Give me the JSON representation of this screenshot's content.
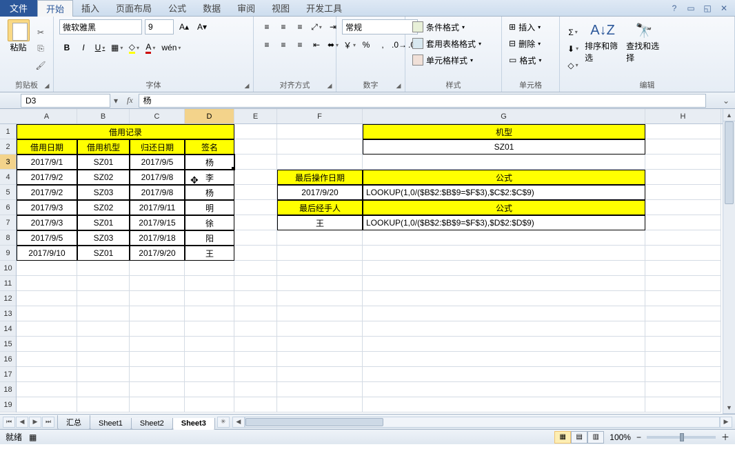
{
  "tabs": {
    "file": "文件",
    "items": [
      "开始",
      "插入",
      "页面布局",
      "公式",
      "数据",
      "审阅",
      "视图",
      "开发工具"
    ],
    "active": 0
  },
  "ribbon": {
    "clipboard": {
      "title": "剪贴板",
      "paste": "粘贴"
    },
    "font": {
      "title": "字体",
      "name": "微软雅黑",
      "size": "9",
      "bold": "B",
      "italic": "I",
      "underline": "U"
    },
    "align": {
      "title": "对齐方式"
    },
    "number": {
      "title": "数字",
      "format": "常规"
    },
    "styles": {
      "title": "样式",
      "cond": "条件格式",
      "tbl": "套用表格格式",
      "cell": "单元格样式"
    },
    "cells": {
      "title": "单元格",
      "ins": "插入",
      "del": "删除",
      "fmt": "格式"
    },
    "edit": {
      "title": "编辑",
      "sort": "排序和筛选",
      "find": "查找和选择"
    }
  },
  "namebox": "D3",
  "formula": "杨",
  "cols": [
    "A",
    "B",
    "C",
    "D",
    "E",
    "F",
    "G",
    "H"
  ],
  "selCol": 3,
  "selRow": 3,
  "data": {
    "title1": "借用记录",
    "h": [
      "借用日期",
      "借用机型",
      "归还日期",
      "签名"
    ],
    "rows": [
      [
        "2017/9/1",
        "SZ01",
        "2017/9/5",
        "杨"
      ],
      [
        "2017/9/2",
        "SZ02",
        "2017/9/8",
        "李"
      ],
      [
        "2017/9/2",
        "SZ03",
        "2017/9/8",
        "杨"
      ],
      [
        "2017/9/3",
        "SZ02",
        "2017/9/11",
        "明"
      ],
      [
        "2017/9/3",
        "SZ01",
        "2017/9/15",
        "徐"
      ],
      [
        "2017/9/5",
        "SZ03",
        "2017/9/18",
        "阳"
      ],
      [
        "2017/9/10",
        "SZ01",
        "2017/9/20",
        "王"
      ]
    ],
    "title2": "机型",
    "model": "SZ01",
    "h2a": "最后操作日期",
    "h2b": "公式",
    "v2a": "2017/9/20",
    "v2b": "LOOKUP(1,0/($B$2:$B$9=$F$3),$C$2:$C$9)",
    "h3a": "最后经手人",
    "h3b": "公式",
    "v3a": "王",
    "v3b": "LOOKUP(1,0/($B$2:$B$9=$F$3),$D$2:$D$9)"
  },
  "sheets": {
    "items": [
      "汇总",
      "Sheet1",
      "Sheet2",
      "Sheet3"
    ],
    "active": 3
  },
  "status": {
    "ready": "就绪",
    "zoom": "100%"
  }
}
